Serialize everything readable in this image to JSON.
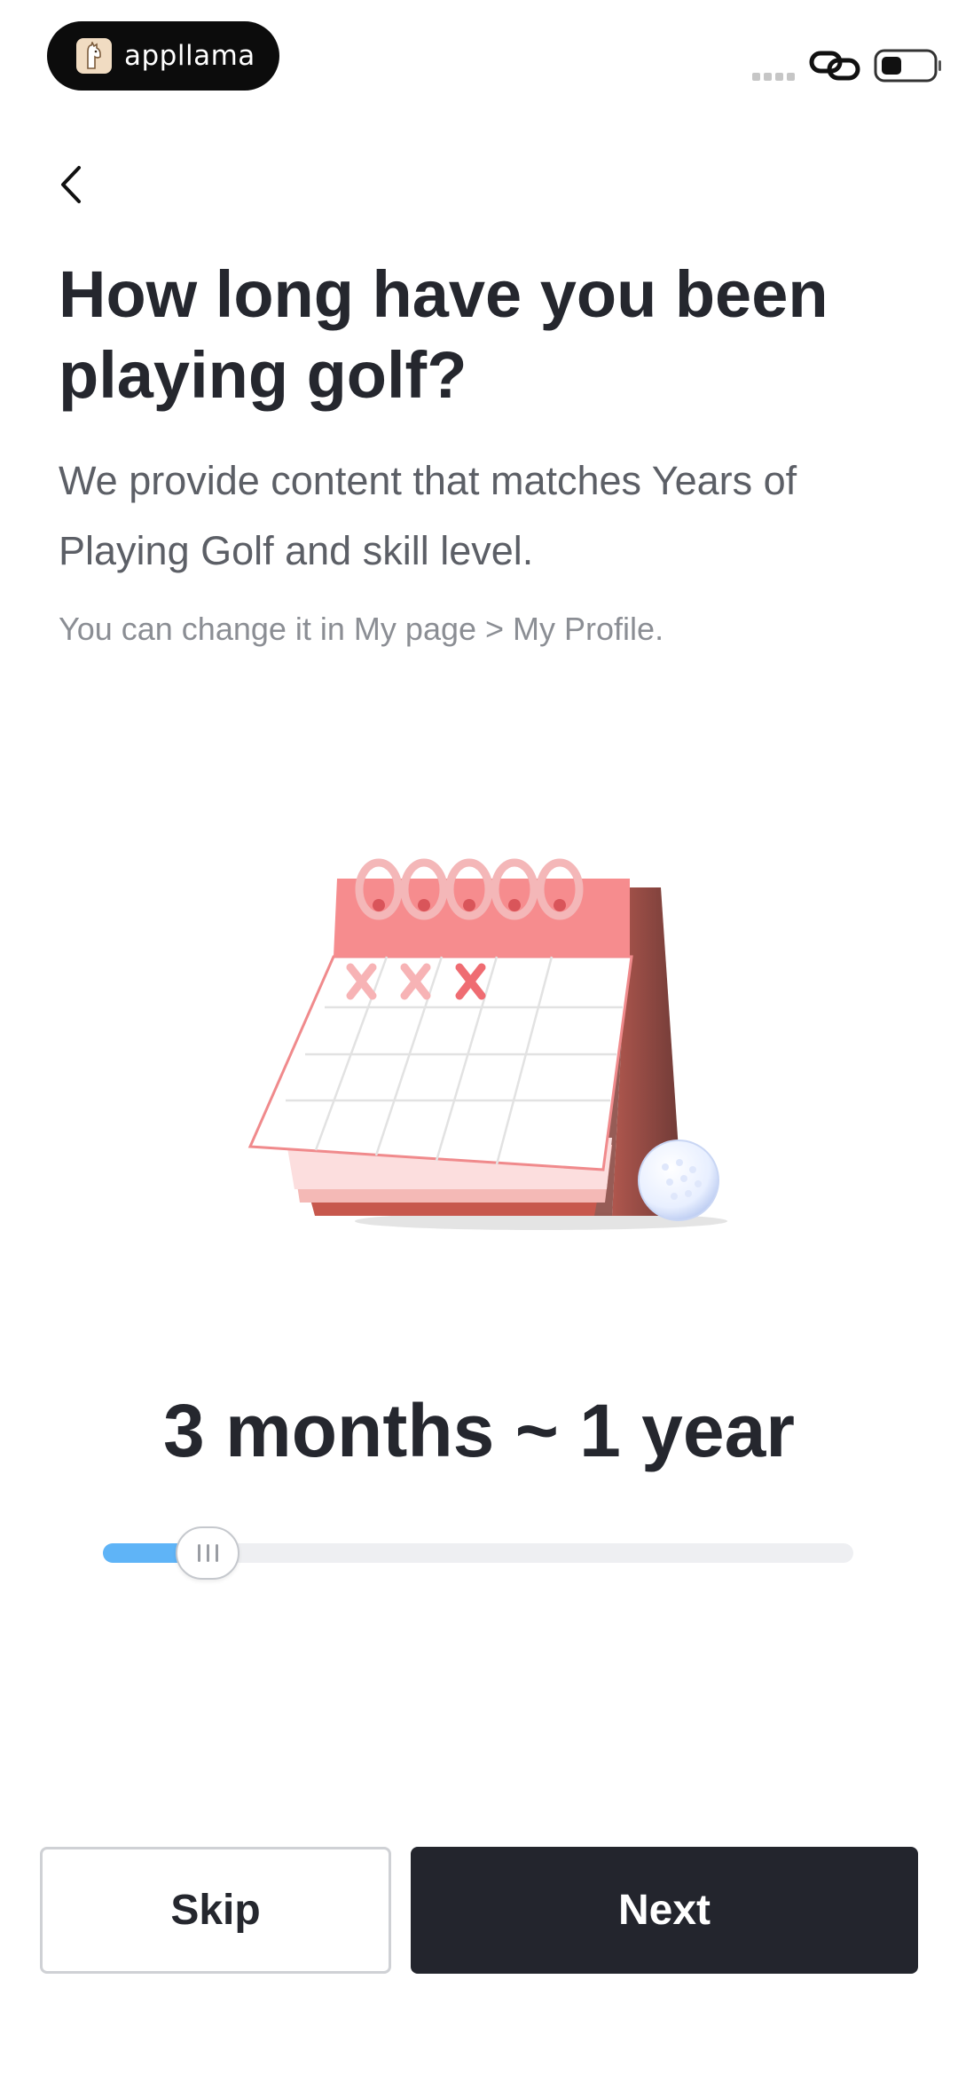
{
  "status_bar": {
    "brand_name": "appllama",
    "icons": [
      "llama-logo-icon",
      "signal-dots-icon",
      "link-icon",
      "battery-icon"
    ]
  },
  "nav": {
    "back_icon": "chevron-left-icon"
  },
  "question": {
    "title": "How long have you been playing golf?",
    "subtitle": "We provide content that matches Years of Playing Golf and skill level.",
    "hint": "You can change it in My page > My Profile."
  },
  "illustration": {
    "icon": "calendar-golf-ball-illustration"
  },
  "selection": {
    "value_label": "3 months ~ 1 year",
    "slider_level": 0.14
  },
  "actions": {
    "skip_label": "Skip",
    "next_label": "Next"
  },
  "colors": {
    "accent": "#5fb4f7",
    "primary_button": "#23252d",
    "calendar_red": "#f0767c"
  }
}
